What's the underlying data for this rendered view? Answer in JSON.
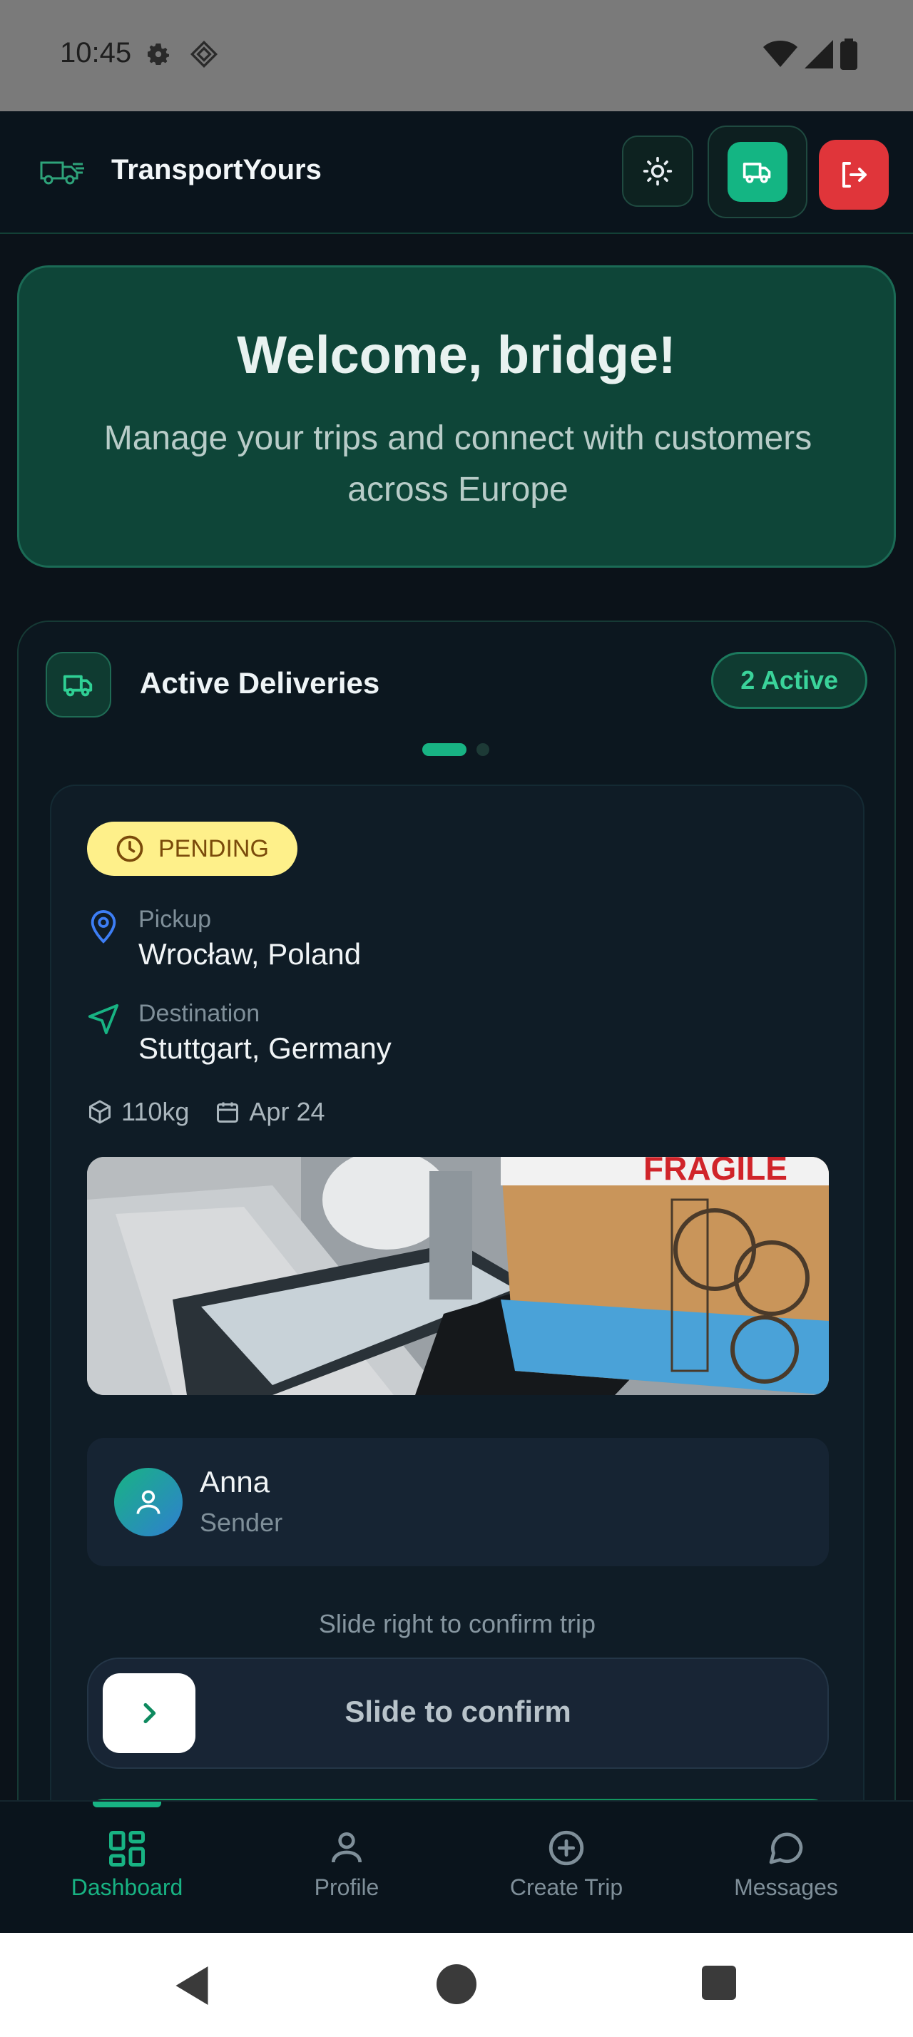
{
  "status_bar": {
    "time": "10:45"
  },
  "header": {
    "app_name": "TransportYours"
  },
  "welcome": {
    "title": "Welcome, bridge!",
    "subtitle": "Manage your trips and connect with customers across Europe"
  },
  "deliveries": {
    "title": "Active Deliveries",
    "badge": "2 Active",
    "trip": {
      "status": "PENDING",
      "pickup_label": "Pickup",
      "pickup_value": "Wrocław, Poland",
      "destination_label": "Destination",
      "destination_value": "Stuttgart, Germany",
      "weight": "110kg",
      "date": "Apr 24",
      "photo_text": "FRAGILE",
      "sender_name": "Anna",
      "sender_role": "Sender",
      "slide_hint": "Slide right to confirm trip",
      "slide_label": "Slide to confirm"
    }
  },
  "nav": {
    "items": [
      {
        "label": "Dashboard",
        "icon": "dashboard-icon"
      },
      {
        "label": "Profile",
        "icon": "profile-icon"
      },
      {
        "label": "Create Trip",
        "icon": "plus-circle-icon"
      },
      {
        "label": "Messages",
        "icon": "chat-icon"
      }
    ],
    "active_index": 0
  },
  "colors": {
    "accent": "#18b383",
    "pending_bg": "#fef08a",
    "logout": "#e0353a",
    "welcome_bg": "#0e4538"
  }
}
